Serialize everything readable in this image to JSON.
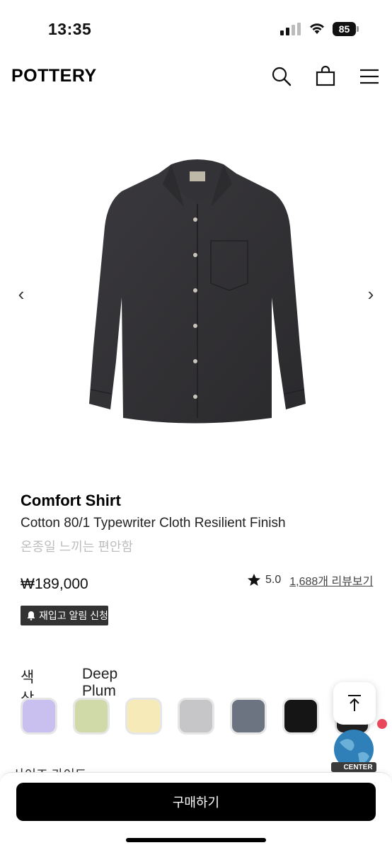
{
  "status_bar": {
    "time": "13:35",
    "battery": "85",
    "icons": [
      "signal-icon",
      "wifi-icon",
      "battery-icon"
    ]
  },
  "header": {
    "logo": "POTTERY",
    "icons": [
      "search-icon",
      "bag-icon",
      "menu-icon"
    ]
  },
  "gallery": {
    "prev_arrow": "‹",
    "next_arrow": "›"
  },
  "product": {
    "name": "Comfort Shirt",
    "description": "Cotton 80/1 Typewriter Cloth Resilient Finish",
    "subtitle": "온종일 느끼는 편안함",
    "price": "₩189,000",
    "rating": "5.0",
    "review_link": "1,688개 리뷰보기",
    "restock_label": "재입고 알림 신청"
  },
  "options": {
    "color_label": "색상",
    "color_value": "Deep Plum",
    "swatches": [
      {
        "name": "lavender",
        "color": "#c9c0f0"
      },
      {
        "name": "sage",
        "color": "#cfdaa8"
      },
      {
        "name": "butter",
        "color": "#f6eab8"
      },
      {
        "name": "light-gray",
        "color": "#c6c6c8"
      },
      {
        "name": "slate",
        "color": "#6b7480"
      },
      {
        "name": "black",
        "color": "#151515"
      },
      {
        "name": "dark",
        "color": "#222222"
      }
    ]
  },
  "size_guide": "사이즈 가이드",
  "floating": {
    "globe_label": "CENTER"
  },
  "bottom_bar": {
    "buy_label": "구매하기"
  }
}
